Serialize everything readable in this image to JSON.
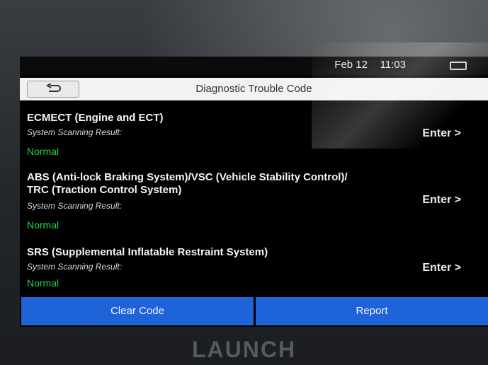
{
  "status_bar": {
    "date": "Feb 12",
    "time": "11:03"
  },
  "header": {
    "title": "Diagnostic Trouble Code",
    "back_icon": "back-arrow-icon"
  },
  "systems": [
    {
      "name": "ECMECT (Engine and ECT)",
      "caption": "System Scanning Result:",
      "status": "Normal",
      "enter_label": "Enter >"
    },
    {
      "name_line1": "ABS (Anti-lock Braking System)/VSC (Vehicle Stability Control)/",
      "name_line2": "TRC (Traction Control System)",
      "caption": "System Scanning Result:",
      "status": "Normal",
      "enter_label": "Enter >"
    },
    {
      "name": "SRS (Supplemental Inflatable Restraint System)",
      "caption": "System Scanning Result:",
      "status": "Normal",
      "enter_label": "Enter >"
    }
  ],
  "footer": {
    "clear_label": "Clear Code",
    "report_label": "Report"
  },
  "device": {
    "brand": "LAUNCH"
  },
  "colors": {
    "status_normal": "#22d64a",
    "button_blue": "#1e63d8"
  }
}
